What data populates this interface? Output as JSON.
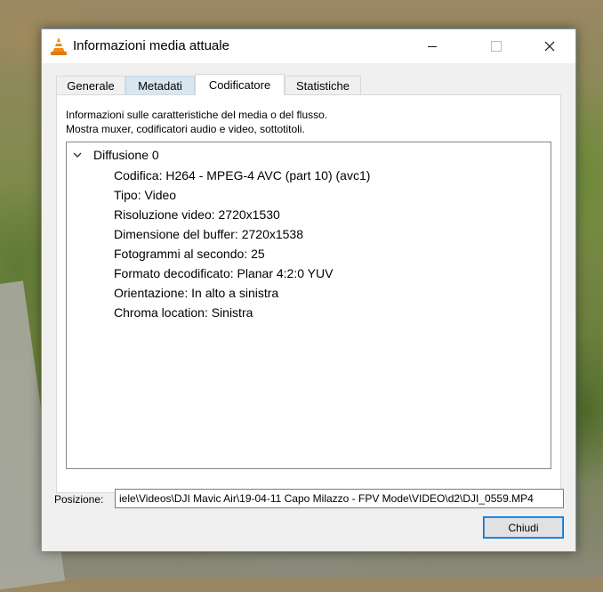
{
  "window": {
    "title": "Informazioni media attuale",
    "icon": "vlc-cone-icon",
    "controls": {
      "minimize": "minimize-icon",
      "maximize": "maximize-icon",
      "close": "close-icon"
    }
  },
  "tabs": [
    {
      "label": "Generale",
      "state": "normal"
    },
    {
      "label": "Metadati",
      "state": "hover"
    },
    {
      "label": "Codificatore",
      "state": "selected"
    },
    {
      "label": "Statistiche",
      "state": "normal"
    }
  ],
  "panel": {
    "description_line1": "Informazioni sulle caratteristiche del media o del flusso.",
    "description_line2": "Mostra muxer, codificatori audio e video, sottotitoli."
  },
  "tree": {
    "root_label": "Diffusione 0",
    "expanded": true,
    "items": [
      "Codifica: H264 - MPEG-4 AVC (part 10) (avc1)",
      "Tipo: Video",
      "Risoluzione video: 2720x1530",
      "Dimensione del buffer: 2720x1538",
      "Fotogrammi al secondo: 25",
      "Formato decodificato: Planar 4:2:0 YUV",
      "Orientazione: In alto a sinistra",
      "Chroma location: Sinistra"
    ]
  },
  "position": {
    "label": "Posizione:",
    "value": "iele\\Videos\\DJI  Mavic  Air\\19-04-11 Capo Milazzo - FPV Mode\\VIDEO\\d2\\DJI_0559.MP4"
  },
  "buttons": {
    "close_label": "Chiudi"
  },
  "colors": {
    "accent": "#0078d7",
    "tab_hover": "#d8e6f2",
    "vlc_orange": "#f08a1a"
  }
}
